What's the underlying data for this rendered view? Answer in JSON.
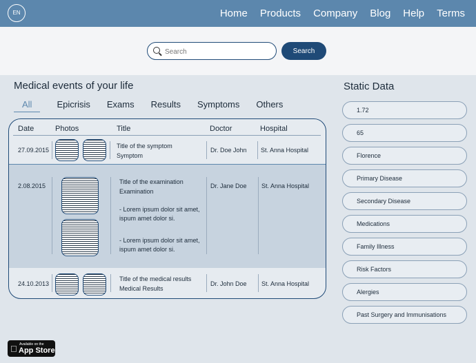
{
  "header": {
    "lang": "EN",
    "nav": [
      "Home",
      "Products",
      "Company",
      "Blog",
      "Help",
      "Terms"
    ]
  },
  "search": {
    "placeholder": "Search",
    "button_label": "Search"
  },
  "events": {
    "title": "Medical events of your life",
    "tabs": [
      "All",
      "Epicrisis",
      "Exams",
      "Results",
      "Symptoms",
      "Others"
    ],
    "active_tab": "All",
    "columns": [
      "Date",
      "Photos",
      "Title",
      "Doctor",
      "Hospital"
    ],
    "rows": [
      {
        "date": "27.09.2015",
        "title_line1": "Title  of the symptom",
        "title_line2": "Symptom",
        "doctor": "Dr. Doe John",
        "hospital": "St. Anna Hospital"
      },
      {
        "date": "2.08.2015",
        "title_line1": "Title  of the examination",
        "title_line2": "Examination",
        "note1_line1": "- Lorem ipsum dolor sit amet,",
        "note1_line2": "ispum amet dolor si.",
        "note2_line1": "- Lorem ipsum dolor sit amet,",
        "note2_line2": "ispum amet dolor si.",
        "doctor": "Dr. Jane Doe",
        "hospital": "St. Anna Hospital"
      },
      {
        "date": "24.10.2013",
        "title_line1": "Title  of the medical results",
        "title_line2": "Medical Results",
        "doctor": "Dr. John Doe",
        "hospital": "St. Anna Hospital"
      }
    ]
  },
  "static": {
    "title": "Static Data",
    "items": [
      "1.72",
      "65",
      "Florence",
      "Primary Disease",
      "Secondary Disease",
      "Medications",
      "Family Illness",
      "Risk Factors",
      "Alergies",
      "Past Surgery and Immunisations"
    ]
  },
  "appstore": {
    "small": "Available on the",
    "big": "App Store"
  },
  "colors": {
    "nav_bg": "#5c87ad",
    "accent": "#1f4a77",
    "page_bg": "#dfe5eb"
  }
}
